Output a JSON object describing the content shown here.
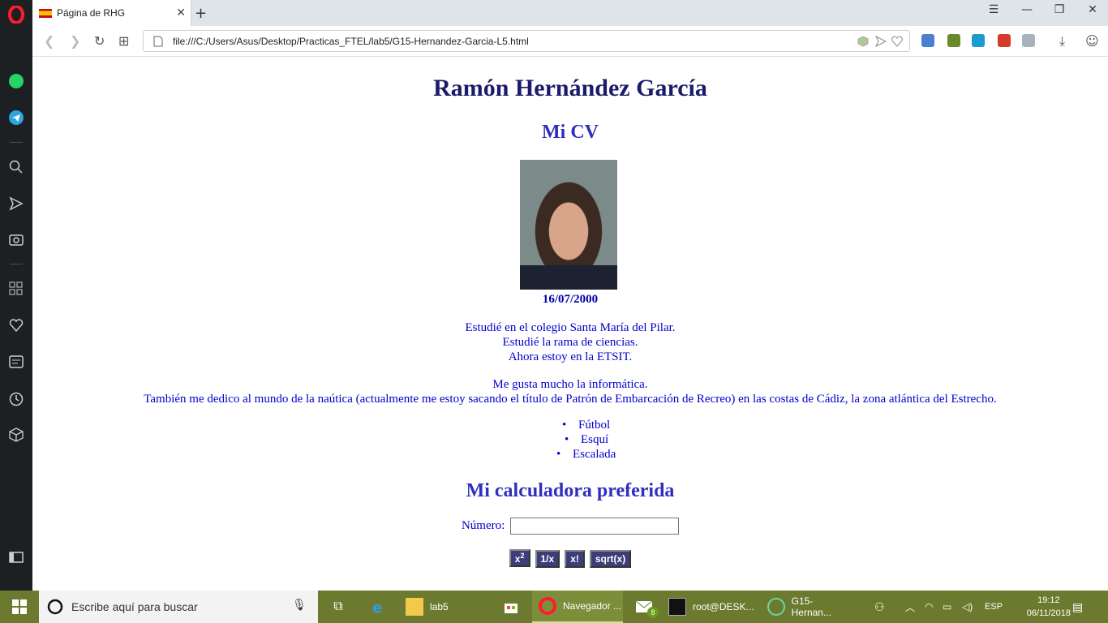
{
  "browser": {
    "tab_title": "Página de RHG",
    "url": "file:///C:/Users/Asus/Desktop/Practicas_FTEL/lab5/G15-Hernandez-Garcia-L5.html"
  },
  "page": {
    "name": "Ramón Hernández García",
    "cv_heading": "Mi CV",
    "birthdate": "16/07/2000",
    "bio_lines": [
      "Estudié en el colegio Santa María del Pilar.",
      "Estudié la rama de ciencias.",
      "Ahora estoy en la ETSIT."
    ],
    "interest_lines": [
      "Me gusta mucho la informática.",
      "También me dedico al mundo de la naútica (actualmente me estoy sacando el título de Patrón de Embarcación de Recreo) en las costas de Cádiz, la zona atlántica del Estrecho."
    ],
    "hobbies": [
      "Fútbol",
      "Esquí",
      "Escalada"
    ],
    "calculator": {
      "heading": "Mi calculadora preferida",
      "label": "Número:",
      "input_value": "",
      "buttons": [
        "x",
        "1/x",
        "x!",
        "sqrt(x)"
      ],
      "square_superscript": "2"
    }
  },
  "taskbar": {
    "search_placeholder": "Escribe aquí para buscar",
    "items": [
      "lab5",
      "Navegador ...",
      "root@DESK...",
      "G15-Hernan..."
    ],
    "mail_badge": "8",
    "language": "ESP",
    "time": "19:12",
    "date": "06/11/2018"
  }
}
